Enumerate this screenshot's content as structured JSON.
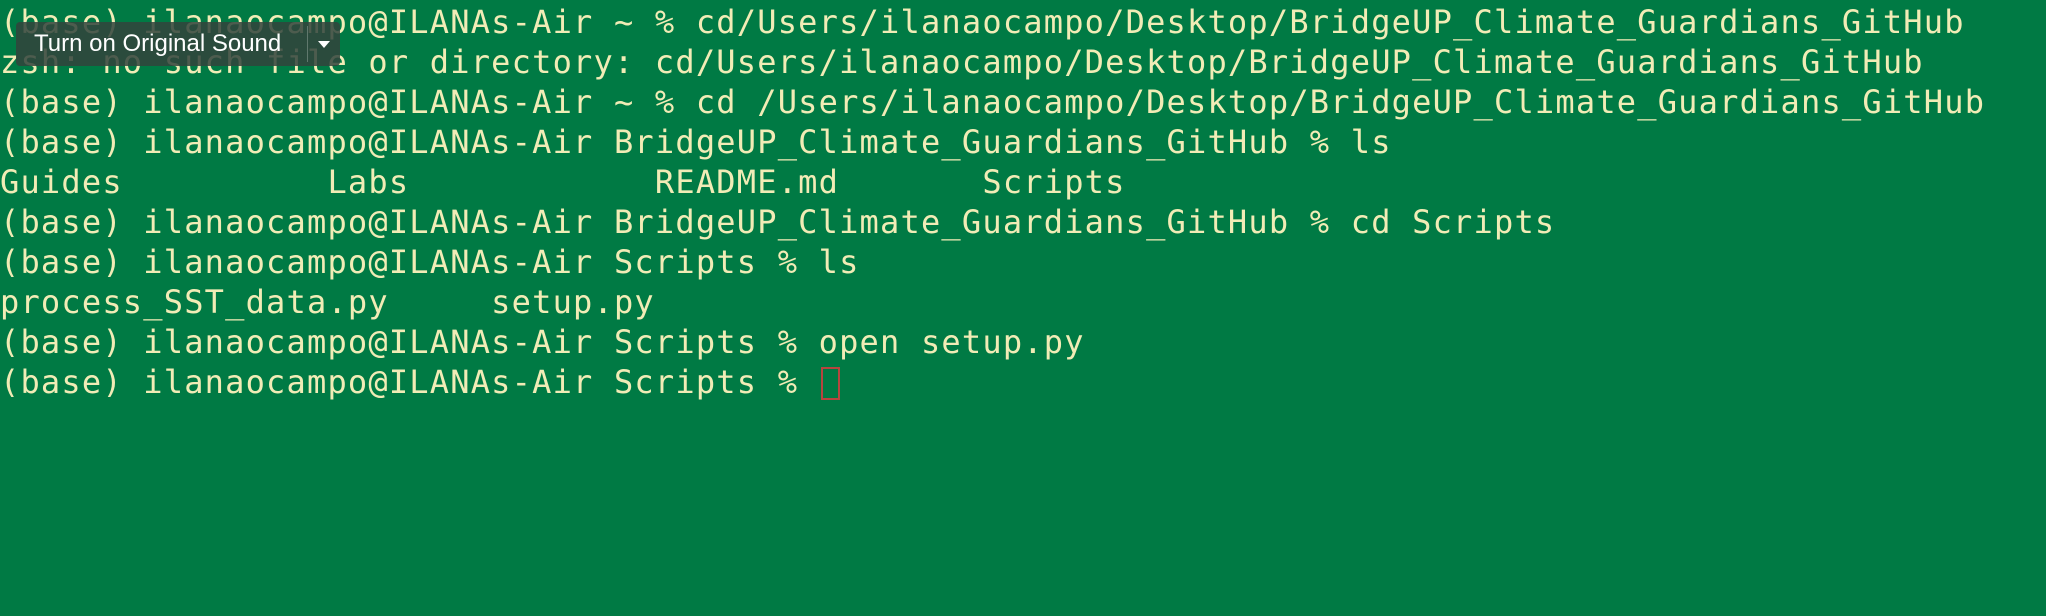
{
  "terminal": {
    "lines": [
      "(base) ilanaocampo@ILANAs-Air ~ % cd/Users/ilanaocampo/Desktop/BridgeUP_Climate_Guardians_GitHub",
      "zsh: no such file or directory: cd/Users/ilanaocampo/Desktop/BridgeUP_Climate_Guardians_GitHub",
      "(base) ilanaocampo@ILANAs-Air ~ % cd /Users/ilanaocampo/Desktop/BridgeUP_Climate_Guardians_GitHub",
      "(base) ilanaocampo@ILANAs-Air BridgeUP_Climate_Guardians_GitHub % ls",
      "Guides          Labs            README.md       Scripts",
      "(base) ilanaocampo@ILANAs-Air BridgeUP_Climate_Guardians_GitHub % cd Scripts",
      "(base) ilanaocampo@ILANAs-Air Scripts % ls",
      "process_SST_data.py     setup.py",
      "(base) ilanaocampo@ILANAs-Air Scripts % open setup.py",
      "(base) ilanaocampo@ILANAs-Air Scripts % "
    ]
  },
  "overlay": {
    "sound_button_label": "Turn on Original Sound",
    "dropdown_icon": "chevron-down-icon"
  },
  "colors": {
    "background": "#007a44",
    "text": "#f1ecb6",
    "cursor": "#b8443e"
  }
}
